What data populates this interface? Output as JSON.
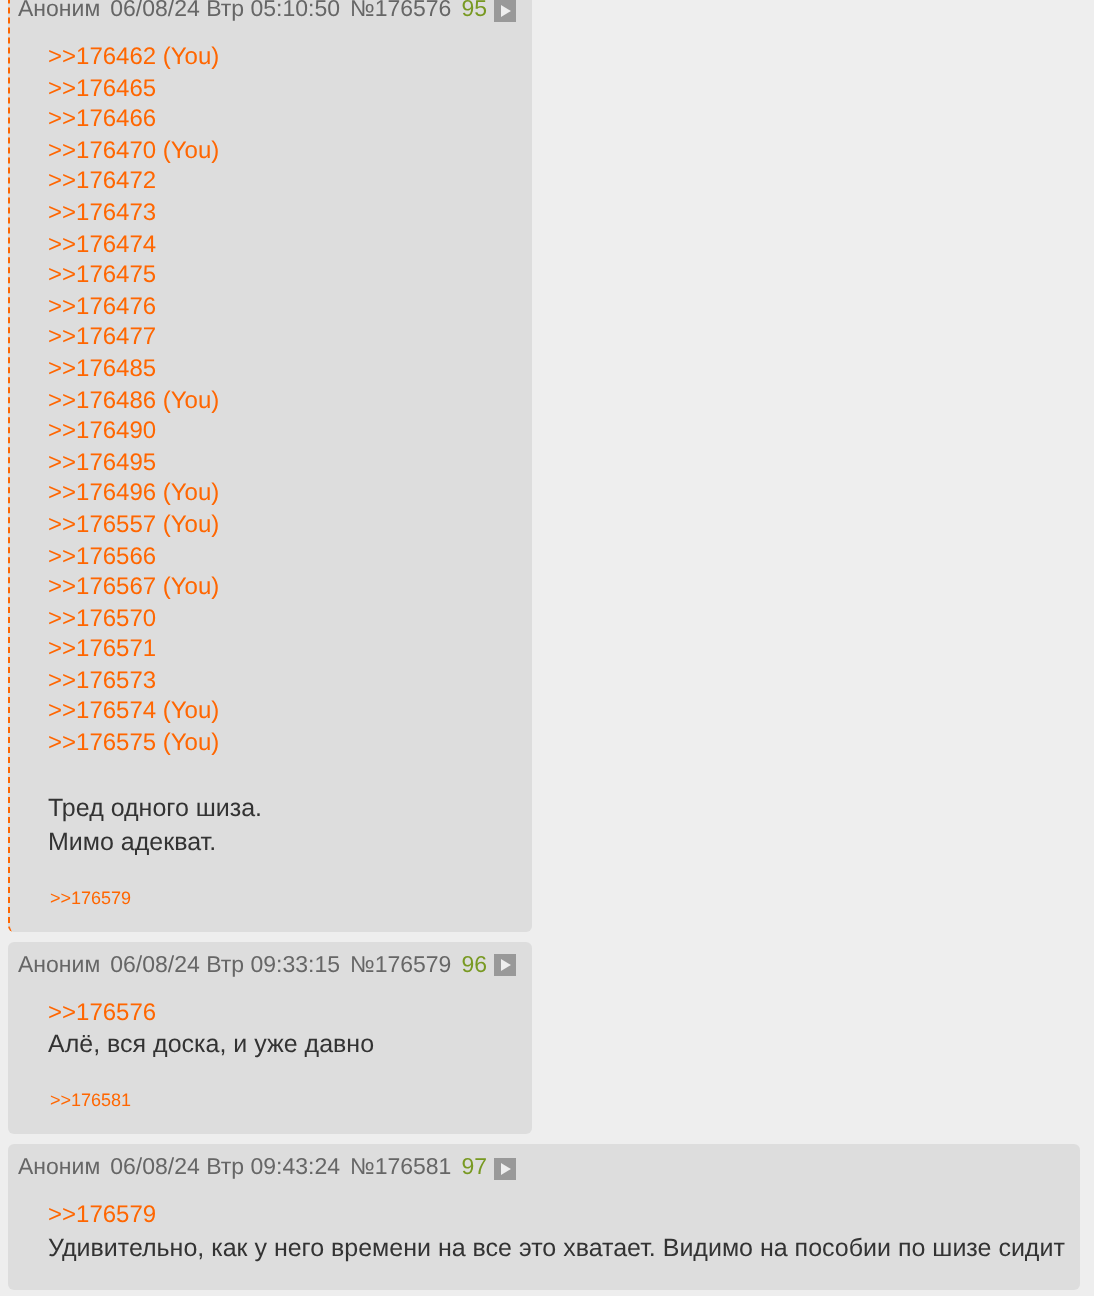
{
  "posts": [
    {
      "name": "Аноним",
      "date": "06/08/24 Втр 05:10:50",
      "number": "№176576",
      "index": "95",
      "marked": true,
      "lines": [
        {
          "kind": "ref",
          "text": ">>176462 (You)"
        },
        {
          "kind": "ref",
          "text": ">>176465"
        },
        {
          "kind": "ref",
          "text": ">>176466"
        },
        {
          "kind": "ref",
          "text": ">>176470 (You)"
        },
        {
          "kind": "ref",
          "text": ">>176472"
        },
        {
          "kind": "ref",
          "text": ">>176473"
        },
        {
          "kind": "ref",
          "text": ">>176474"
        },
        {
          "kind": "ref",
          "text": ">>176475"
        },
        {
          "kind": "ref",
          "text": ">>176476"
        },
        {
          "kind": "ref",
          "text": ">>176477"
        },
        {
          "kind": "ref",
          "text": ">>176485"
        },
        {
          "kind": "ref",
          "text": ">>176486 (You)"
        },
        {
          "kind": "ref",
          "text": ">>176490"
        },
        {
          "kind": "ref",
          "text": ">>176495"
        },
        {
          "kind": "ref",
          "text": ">>176496 (You)"
        },
        {
          "kind": "ref",
          "text": ">>176557 (You)"
        },
        {
          "kind": "ref",
          "text": ">>176566"
        },
        {
          "kind": "ref",
          "text": ">>176567 (You)"
        },
        {
          "kind": "ref",
          "text": ">>176570"
        },
        {
          "kind": "ref",
          "text": ">>176571"
        },
        {
          "kind": "ref",
          "text": ">>176573"
        },
        {
          "kind": "ref",
          "text": ">>176574 (You)"
        },
        {
          "kind": "ref",
          "text": ">>176575 (You)"
        },
        {
          "kind": "gap"
        },
        {
          "kind": "text",
          "text": "Тред одного шиза."
        },
        {
          "kind": "text",
          "text": "Мимо адекват."
        }
      ],
      "replies": [
        ">>176579"
      ]
    },
    {
      "name": "Аноним",
      "date": "06/08/24 Втр 09:33:15",
      "number": "№176579",
      "index": "96",
      "marked": false,
      "lines": [
        {
          "kind": "ref",
          "text": ">>176576"
        },
        {
          "kind": "text",
          "text": "Алё, вся доска, и уже давно"
        }
      ],
      "replies": [
        ">>176581"
      ]
    },
    {
      "name": "Аноним",
      "date": "06/08/24 Втр 09:43:24",
      "number": "№176581",
      "index": "97",
      "marked": false,
      "lines": [
        {
          "kind": "ref",
          "text": ">>176579"
        },
        {
          "kind": "text",
          "text": "Удивительно, как у него времени на все это хватает. Видимо на пособии по шизе сидит"
        }
      ]
    }
  ]
}
